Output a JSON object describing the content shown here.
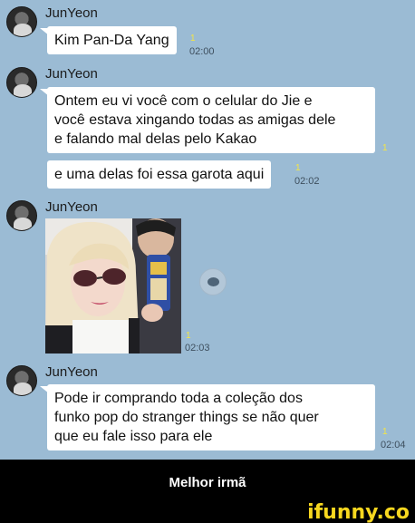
{
  "colors": {
    "chat_background": "#9bbbd4",
    "bubble": "#ffffff",
    "unread_badge": "#f5e642",
    "caption_bar": "#000000",
    "watermark": "#f7d71f"
  },
  "messages": [
    {
      "sender": "JunYeon",
      "bubbles": [
        {
          "text": "Kim Pan-Da Yang",
          "unread": "1",
          "time": "02:00"
        }
      ]
    },
    {
      "sender": "JunYeon",
      "bubbles": [
        {
          "text": "Ontem eu vi você com o celular do Jie e\nvocê estava xingando todas as amigas dele\ne falando mal delas pelo Kakao",
          "unread": "1",
          "time": ""
        },
        {
          "text": "e uma delas foi essa garota aqui",
          "unread": "1",
          "time": "02:02"
        }
      ]
    },
    {
      "sender": "JunYeon",
      "photo": {
        "unread": "1",
        "time": "02:03",
        "share_icon": "speech-bubble-icon"
      }
    },
    {
      "sender": "JunYeon",
      "bubbles": [
        {
          "text": "Pode ir comprando toda a coleção dos\nfunko pop do stranger things se não quer\nque eu fale isso para ele",
          "unread": "1",
          "time": "02:04"
        }
      ]
    }
  ],
  "caption": "Melhor irmã",
  "watermark": "ifunny.co"
}
